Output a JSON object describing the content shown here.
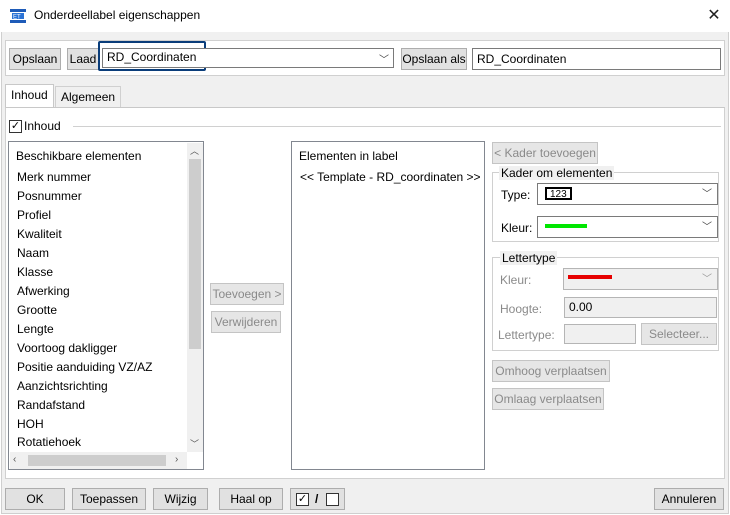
{
  "window": {
    "title": "Onderdeellabel eigenschappen",
    "close_glyph": "✕"
  },
  "toolbar": {
    "save_label": "Opslaan",
    "load_label": "Laad",
    "preset_value": "RD_Coordinaten",
    "save_as_label": "Opslaan als",
    "save_as_value": "RD_Coordinaten"
  },
  "tabs": [
    {
      "label": "Inhoud",
      "active": true
    },
    {
      "label": "Algemeen",
      "active": false
    }
  ],
  "content": {
    "inhoud_label": "Inhoud",
    "inhoud_checked": true
  },
  "available": {
    "header": "Beschikbare elementen",
    "items": [
      "Merk nummer",
      "Posnummer",
      "Profiel",
      "Kwaliteit",
      "Naam",
      "Klasse",
      "Afwerking",
      "Grootte",
      "Lengte",
      "Voortoog dakligger",
      "Positie aanduiding VZ/AZ",
      "Aanzichtsrichting",
      "Randafstand",
      "HOH",
      "Rotatiehoek"
    ]
  },
  "middle_buttons": {
    "add_label": "Toevoegen >",
    "remove_label": "Verwijderen"
  },
  "in_label": {
    "header": "Elementen in label",
    "items": [
      "<< Template - RD_coordinaten >>"
    ]
  },
  "frame": {
    "add_frame_label": "< Kader toevoegen",
    "group_label": "Kader om elementen",
    "type_label": "Type:",
    "type_value": "123",
    "color_label": "Kleur:",
    "color_swatch": "#00e600"
  },
  "font": {
    "group_label": "Lettertype",
    "color_label": "Kleur:",
    "color_swatch": "#e60000",
    "height_label": "Hoogte:",
    "height_value": "0.00",
    "font_label": "Lettertype:",
    "select_label": "Selecteer..."
  },
  "move": {
    "up_label": "Omhoog verplaatsen",
    "down_label": "Omlaag verplaatsen"
  },
  "bottom": {
    "ok_label": "OK",
    "apply_label": "Toepassen",
    "modify_label": "Wijzig",
    "get_label": "Haal op",
    "toggle_slash": "/",
    "cancel_label": "Annuleren"
  }
}
